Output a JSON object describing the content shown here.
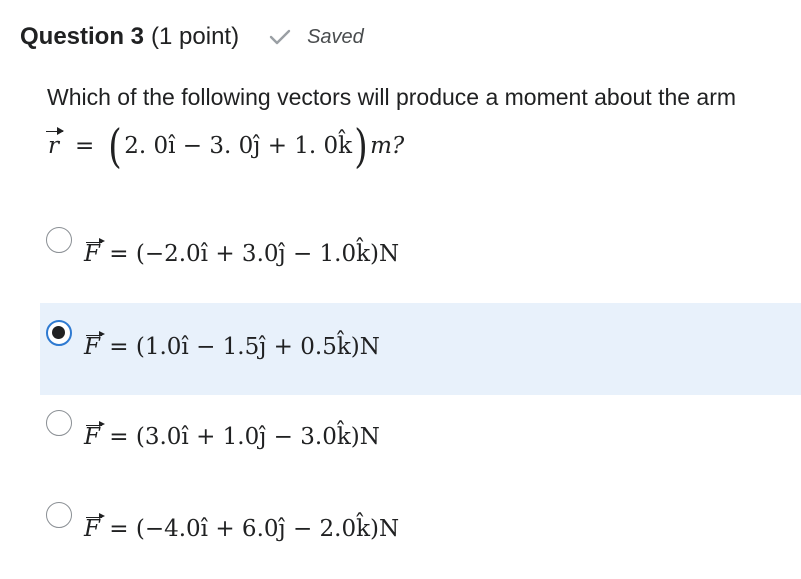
{
  "question": {
    "title": "Question 3",
    "points": "(1 point)",
    "status_label": "Saved",
    "status_icon": "checkmark-icon",
    "prompt": "Which of the following vectors will produce a moment about the arm",
    "arm_vector": {
      "symbol": "r",
      "equals": "=",
      "components": "2. 0î − 3. 0ĵ + 1. 0k̂",
      "unit": "m?"
    }
  },
  "options": [
    {
      "symbol": "F",
      "expression": " = (−2.0î + 3.0ĵ − 1.0k̂)N",
      "selected": false
    },
    {
      "symbol": "F",
      "expression": " = (1.0î − 1.5ĵ + 0.5k̂)N",
      "selected": true
    },
    {
      "symbol": "F",
      "expression": " = (3.0î + 1.0ĵ − 3.0k̂)N",
      "selected": false
    },
    {
      "symbol": "F",
      "expression": " = (−4.0î + 6.0ĵ − 2.0k̂)N",
      "selected": false
    }
  ],
  "colors": {
    "selected_background": "#e8f1fb",
    "radio_focus_ring": "#2e7ad1",
    "text": "#202122",
    "muted": "#494c4e"
  }
}
